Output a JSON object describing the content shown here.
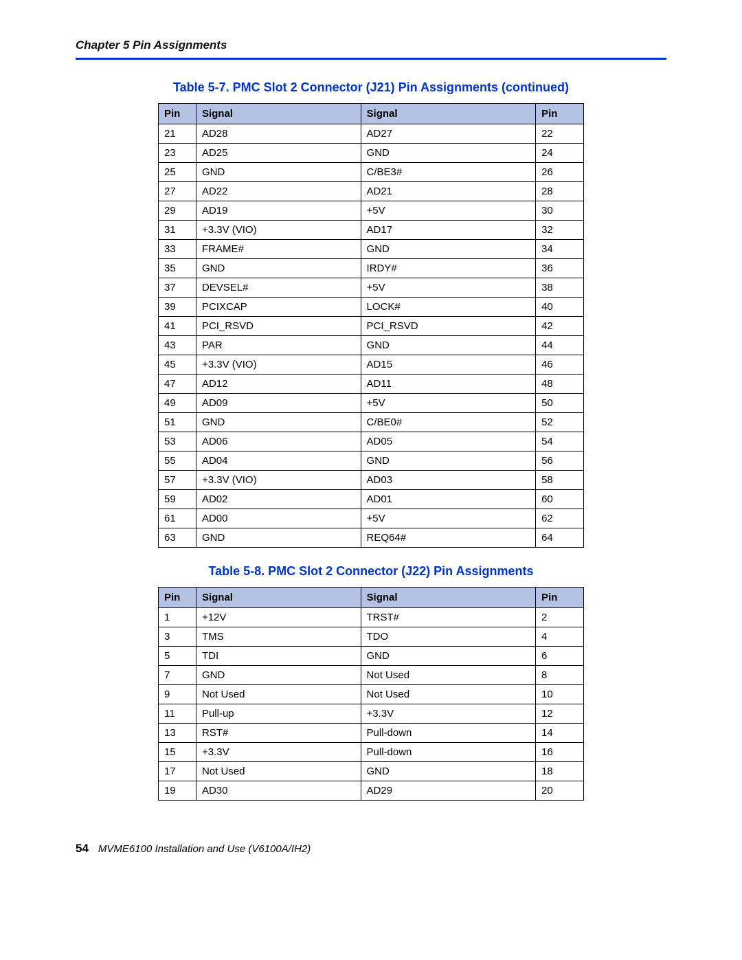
{
  "header": {
    "chapter": "Chapter 5  Pin Assignments"
  },
  "table1": {
    "title": "Table 5-7. PMC Slot 2 Connector (J21) Pin Assignments (continued)",
    "columns": [
      "Pin",
      "Signal",
      "Signal",
      "Pin"
    ],
    "rows": [
      [
        "21",
        "AD28",
        "AD27",
        "22"
      ],
      [
        "23",
        "AD25",
        "GND",
        "24"
      ],
      [
        "25",
        "GND",
        "C/BE3#",
        "26"
      ],
      [
        "27",
        "AD22",
        "AD21",
        "28"
      ],
      [
        "29",
        "AD19",
        "+5V",
        "30"
      ],
      [
        "31",
        "+3.3V (VIO)",
        "AD17",
        "32"
      ],
      [
        "33",
        "FRAME#",
        "GND",
        "34"
      ],
      [
        "35",
        "GND",
        "IRDY#",
        "36"
      ],
      [
        "37",
        "DEVSEL#",
        "+5V",
        "38"
      ],
      [
        "39",
        "PCIXCAP",
        "LOCK#",
        "40"
      ],
      [
        "41",
        "PCI_RSVD",
        "PCI_RSVD",
        "42"
      ],
      [
        "43",
        "PAR",
        "GND",
        "44"
      ],
      [
        "45",
        "+3.3V (VIO)",
        "AD15",
        "46"
      ],
      [
        "47",
        "AD12",
        "AD11",
        "48"
      ],
      [
        "49",
        "AD09",
        "+5V",
        "50"
      ],
      [
        "51",
        "GND",
        "C/BE0#",
        "52"
      ],
      [
        "53",
        "AD06",
        "AD05",
        "54"
      ],
      [
        "55",
        "AD04",
        "GND",
        "56"
      ],
      [
        "57",
        "+3.3V (VIO)",
        "AD03",
        "58"
      ],
      [
        "59",
        "AD02",
        "AD01",
        "60"
      ],
      [
        "61",
        "AD00",
        "+5V",
        "62"
      ],
      [
        "63",
        "GND",
        "REQ64#",
        "64"
      ]
    ]
  },
  "table2": {
    "title": "Table 5-8. PMC Slot 2 Connector (J22) Pin Assignments",
    "columns": [
      "Pin",
      "Signal",
      "Signal",
      "Pin"
    ],
    "rows": [
      [
        "1",
        "+12V",
        "TRST#",
        "2"
      ],
      [
        "3",
        "TMS",
        "TDO",
        "4"
      ],
      [
        "5",
        "TDI",
        "GND",
        "6"
      ],
      [
        "7",
        "GND",
        "Not Used",
        "8"
      ],
      [
        "9",
        "Not Used",
        "Not Used",
        "10"
      ],
      [
        "11",
        "Pull-up",
        "+3.3V",
        "12"
      ],
      [
        "13",
        "RST#",
        "Pull-down",
        "14"
      ],
      [
        "15",
        "+3.3V",
        "Pull-down",
        "16"
      ],
      [
        "17",
        "Not Used",
        "GND",
        "18"
      ],
      [
        "19",
        "AD30",
        "AD29",
        "20"
      ]
    ]
  },
  "footer": {
    "page_number": "54",
    "book_title": "MVME6100 Installation and Use (V6100A/IH2)"
  }
}
